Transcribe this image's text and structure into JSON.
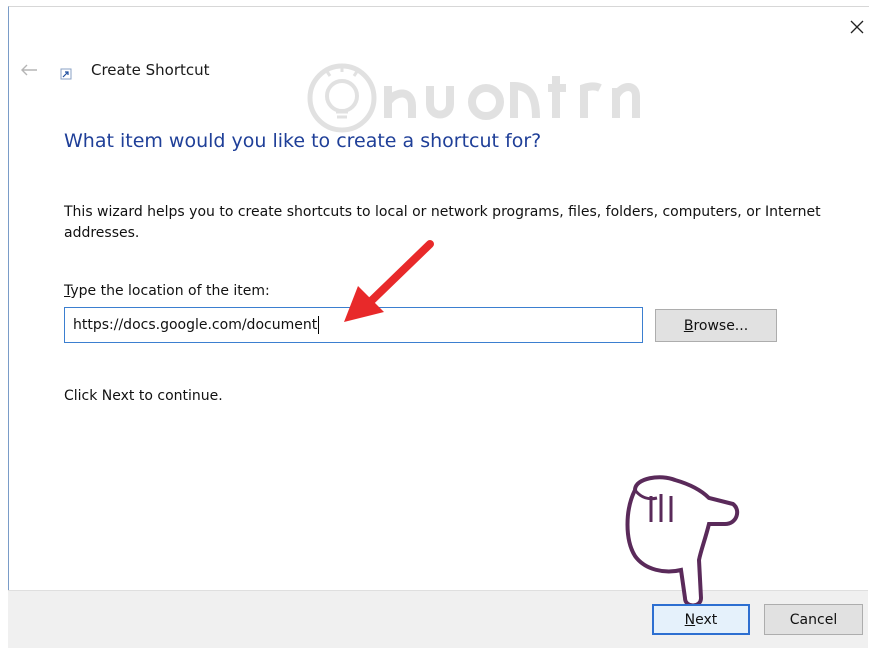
{
  "dialog": {
    "title": "Create Shortcut",
    "heading": "What item would you like to create a shortcut for?",
    "description": "This wizard helps you to create shortcuts to local or network programs, files, folders, computers, or Internet addresses.",
    "location_label_access": "T",
    "location_label_rest": "ype the location of the item:",
    "location_value": "https://docs.google.com/document",
    "browse_access": "B",
    "browse_rest": "rowse...",
    "continue_text": "Click Next to continue.",
    "next_access": "N",
    "next_rest": "ext",
    "cancel_label": "Cancel"
  },
  "icons": {
    "close": "close-icon",
    "back": "back-arrow-icon",
    "wizard": "shortcut-wizard-icon",
    "pointer_arrow": "red-arrow-annotation",
    "hand": "pointing-hand-annotation"
  },
  "colors": {
    "heading": "#1f3f98",
    "input_border": "#3b7fd0",
    "next_border": "#2d6fd1",
    "annotation": "#e8292a",
    "hand": "#5a2a5a"
  }
}
